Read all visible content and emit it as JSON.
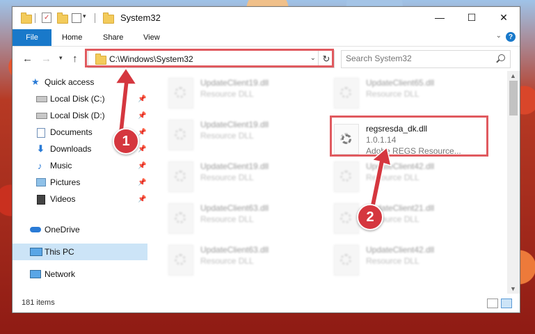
{
  "window": {
    "title": "System32",
    "controls": {
      "minimize": "—",
      "maximize": "☐",
      "close": "✕"
    }
  },
  "ribbon": {
    "tabs": [
      "File",
      "Home",
      "Share",
      "View"
    ],
    "help": "?"
  },
  "address": {
    "path": "C:\\Windows\\System32",
    "refresh_glyph": "↻"
  },
  "search": {
    "placeholder": "Search System32"
  },
  "sidebar": {
    "items": [
      {
        "label": "Quick access",
        "icon": "star-icon",
        "pinned": false
      },
      {
        "label": "Local Disk (C:)",
        "icon": "drive-icon",
        "pinned": true
      },
      {
        "label": "Local Disk (D:)",
        "icon": "drive-icon",
        "pinned": true
      },
      {
        "label": "Documents",
        "icon": "documents-icon",
        "pinned": true
      },
      {
        "label": "Downloads",
        "icon": "download-icon",
        "pinned": true
      },
      {
        "label": "Music",
        "icon": "music-icon",
        "pinned": true
      },
      {
        "label": "Pictures",
        "icon": "pictures-icon",
        "pinned": true
      },
      {
        "label": "Videos",
        "icon": "videos-icon",
        "pinned": true
      },
      {
        "label": "OneDrive",
        "icon": "cloud-icon",
        "pinned": false
      },
      {
        "label": "This PC",
        "icon": "computer-icon",
        "pinned": false,
        "selected": true
      },
      {
        "label": "Network",
        "icon": "network-icon",
        "pinned": false
      }
    ]
  },
  "files": [
    {
      "name": "UpdateClient19.dll",
      "desc": "Resource DLL"
    },
    {
      "name": "UpdateClient65.dll",
      "desc": "Resource DLL"
    },
    {
      "name": "UpdateClient19.dll",
      "desc": "Resource DLL"
    },
    {
      "name": "regsresda_dk.dll",
      "version": "1.0.1.14",
      "desc": "Adobe REGS Resource...",
      "highlighted": true
    },
    {
      "name": "UpdateClient19.dll",
      "desc": "Resource DLL"
    },
    {
      "name": "UpdateClient42.dll",
      "desc": "Resource DLL"
    },
    {
      "name": "UpdateClient63.dll",
      "desc": "Resource DLL"
    },
    {
      "name": "UpdateClient21.dll",
      "desc": "Resource DLL"
    },
    {
      "name": "UpdateClient63.dll",
      "desc": "Resource DLL"
    },
    {
      "name": "UpdateClient42.dll",
      "desc": "Resource DLL"
    }
  ],
  "status": {
    "item_count": "181 items"
  },
  "markers": [
    "1",
    "2"
  ],
  "colors": {
    "accent": "#1979ca",
    "highlight": "#e05a5f",
    "marker": "#d5373f",
    "selection": "#cce4f7"
  }
}
